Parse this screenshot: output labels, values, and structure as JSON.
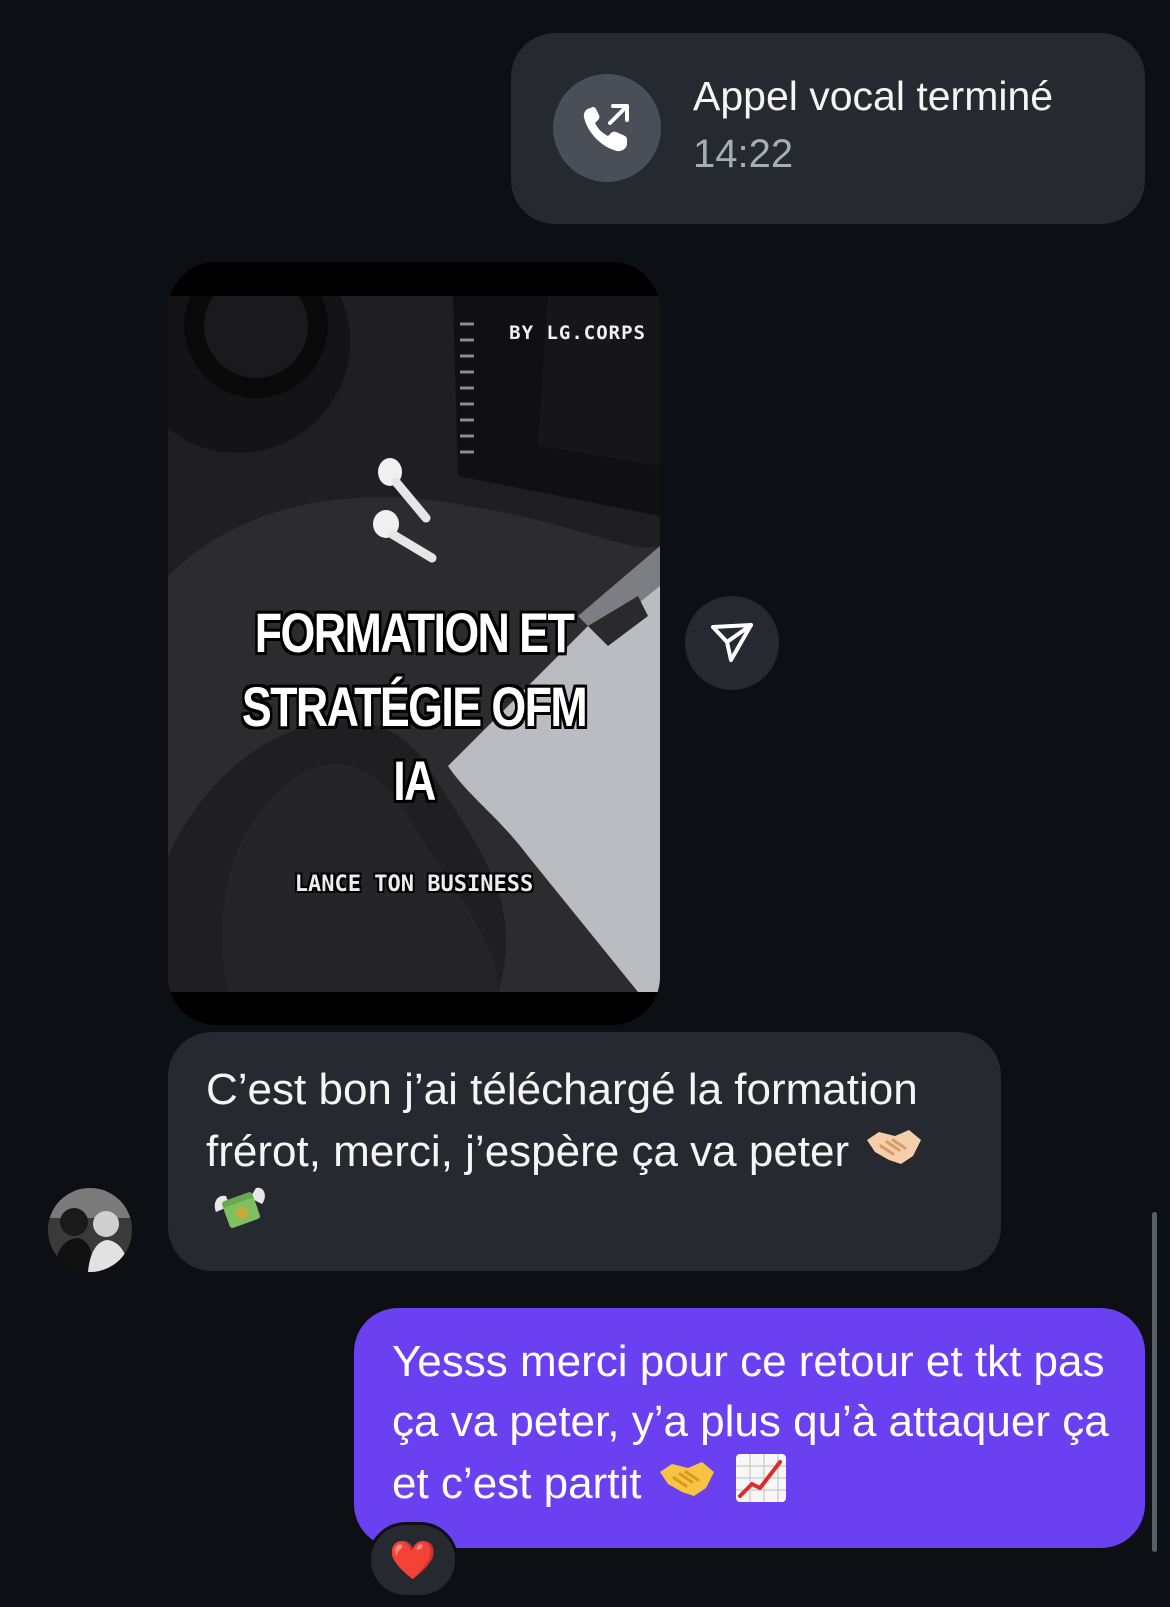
{
  "call": {
    "title": "Appel vocal terminé",
    "time": "14:22",
    "icon": "phone-outgoing-icon"
  },
  "shared_post": {
    "byline": "BY LG.CORPS",
    "title_line1": "FORMATION ET",
    "title_line2": "STRATÉGIE OFM IA",
    "tagline": "LANCE TON BUSINESS",
    "share_icon": "send-icon"
  },
  "incoming_message": {
    "text": "C’est bon j’ai téléchargé la formation frérot, merci, j’espère ça va peter",
    "emojis": [
      "handshake-emoji",
      "money-with-wings-emoji"
    ]
  },
  "outgoing_message": {
    "text": "Yesss merci pour ce retour et tkt pas ça va peter, y’a plus qu’à attaquer ça et c’est partit",
    "emojis": [
      "handshake-emoji",
      "chart-increasing-emoji"
    ],
    "reaction": "❤️"
  },
  "colors": {
    "background": "#0c1014",
    "bubble_incoming": "#262a30",
    "bubble_outgoing": "#6a40f0",
    "secondary_text": "#a8adb3"
  }
}
